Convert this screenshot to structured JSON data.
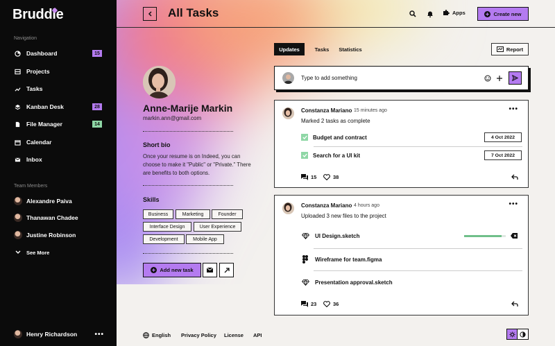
{
  "app": {
    "name": "Bruddle"
  },
  "sidebar": {
    "nav_heading": "Navigation",
    "items": [
      {
        "label": "Dashboard",
        "badge": "15",
        "badge_color": "#b47bf0"
      },
      {
        "label": "Projects"
      },
      {
        "label": "Tasks"
      },
      {
        "label": "Kanban Desk",
        "badge": "28",
        "badge_color": "#b47bf0"
      },
      {
        "label": "File Manager",
        "badge": "14",
        "badge_color": "#8fd7a6"
      },
      {
        "label": "Calendar"
      },
      {
        "label": "Inbox"
      }
    ],
    "team_heading": "Team Members",
    "members": [
      {
        "name": "Alexandre Paiva"
      },
      {
        "name": "Thanawan Chadee"
      },
      {
        "name": "Justine Robinson"
      }
    ],
    "see_more": "See More",
    "current_user": "Henry Richardson"
  },
  "header": {
    "title": "All Tasks",
    "apps_label": "Apps",
    "create_label": "Create new"
  },
  "profile": {
    "name": "Anne-Marije Markin",
    "email": "markin.ann@gmail.com",
    "bio_title": "Short bio",
    "bio": "Once your resume is on Indeed, you can choose to make it \"Public\" or \"Private.\" There are benefits to both options.",
    "skills_title": "Skills",
    "skills": [
      "Business",
      "Marketing",
      "Founder",
      "Interface Design",
      "User Experience",
      "Development",
      "Mobile App"
    ],
    "add_task_label": "Add new task"
  },
  "tabs": [
    {
      "label": "Updates",
      "active": true
    },
    {
      "label": "Tasks"
    },
    {
      "label": "Statistics"
    }
  ],
  "report_label": "Report",
  "composer": {
    "placeholder": "Type to add something"
  },
  "feed": [
    {
      "author": "Constanza Mariano",
      "time": "15 minutes ago",
      "message": "Marked 2 tasks as complete",
      "tasks": [
        {
          "title": "Budget and contract",
          "date": "4 Oct 2022"
        },
        {
          "title": "Search for a UI kit",
          "date": "7 Oct 2022"
        }
      ],
      "comments": "15",
      "likes": "38"
    },
    {
      "author": "Constanza Mariano",
      "time": "4 hours ago",
      "message": "Uploaded 3 new files to the project",
      "files": [
        {
          "name": "UI Design.sketch",
          "icon": "sketch-icon",
          "progress": 0.9
        },
        {
          "name": "Wireframe for team.figma",
          "icon": "figma-icon"
        },
        {
          "name": "Presentation approval.sketch",
          "icon": "sketch-icon"
        }
      ],
      "comments": "23",
      "likes": "36"
    }
  ],
  "footer": {
    "language": "English",
    "links": [
      "Privacy Policy",
      "License",
      "API"
    ]
  },
  "colors": {
    "accent": "#b47bf0",
    "success": "#8fd7a6",
    "dark": "#0b0b0b"
  }
}
